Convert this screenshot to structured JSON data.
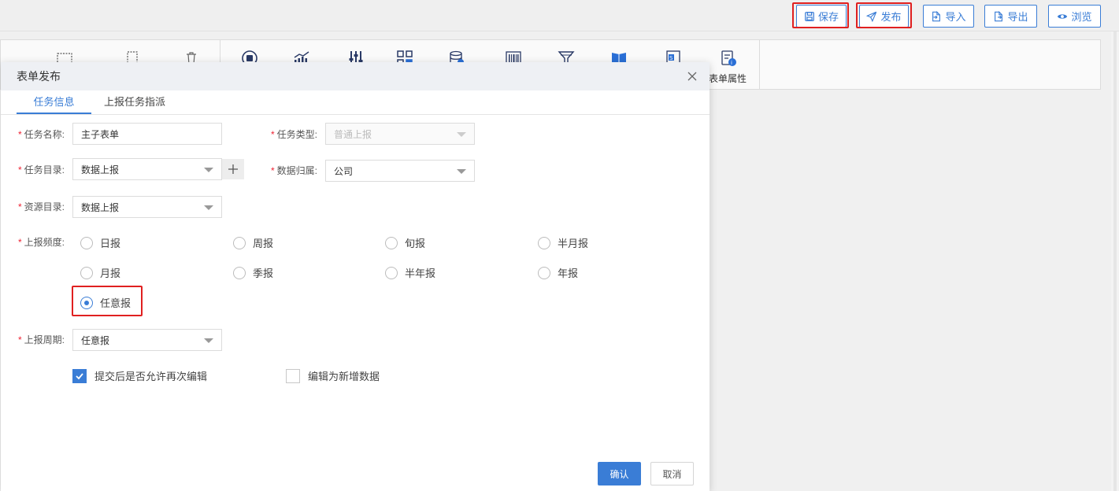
{
  "topbar": {
    "buttons": [
      {
        "label": "保存",
        "icon": "save-icon"
      },
      {
        "label": "发布",
        "icon": "send-icon"
      },
      {
        "label": "导入",
        "icon": "import-icon"
      },
      {
        "label": "导出",
        "icon": "export-icon"
      },
      {
        "label": "浏览",
        "icon": "eye-icon"
      }
    ]
  },
  "toolbar": {
    "visible_label": "表单属性",
    "icons": [
      "table-icon",
      "column-icon",
      "delete-icon",
      "record-icon",
      "chart-icon",
      "adjust-icon",
      "grid-icon",
      "database-icon",
      "barcode-icon",
      "filter-icon",
      "book-icon",
      "sheet-icon",
      "form-props-icon"
    ]
  },
  "modal": {
    "title": "表单发布",
    "tabs": [
      {
        "label": "任务信息",
        "active": true
      },
      {
        "label": "上报任务指派",
        "active": false
      }
    ],
    "fields": {
      "task_name": {
        "label": "任务名称:",
        "value": "主子表单"
      },
      "task_type": {
        "label": "任务类型:",
        "value": "普通上报"
      },
      "task_dir": {
        "label": "任务目录:",
        "value": "数据上报"
      },
      "data_owner": {
        "label": "数据归属:",
        "value": "公司"
      },
      "resource_dir": {
        "label": "资源目录:",
        "value": "数据上报"
      },
      "frequency": {
        "label": "上报频度:"
      },
      "period": {
        "label": "上报周期:",
        "value": "任意报"
      }
    },
    "frequency_options": [
      {
        "label": "日报",
        "checked": false
      },
      {
        "label": "周报",
        "checked": false
      },
      {
        "label": "旬报",
        "checked": false
      },
      {
        "label": "半月报",
        "checked": false
      },
      {
        "label": "月报",
        "checked": false
      },
      {
        "label": "季报",
        "checked": false
      },
      {
        "label": "半年报",
        "checked": false
      },
      {
        "label": "年报",
        "checked": false
      },
      {
        "label": "任意报",
        "checked": true
      }
    ],
    "checkboxes": [
      {
        "label": "提交后是否允许再次编辑",
        "checked": true
      },
      {
        "label": "编辑为新增数据",
        "checked": false
      }
    ],
    "confirm_label": "确认",
    "cancel_label": "取消"
  },
  "colors": {
    "accent": "#3a7dd6",
    "highlight": "#e02020",
    "required": "#ee2233"
  }
}
